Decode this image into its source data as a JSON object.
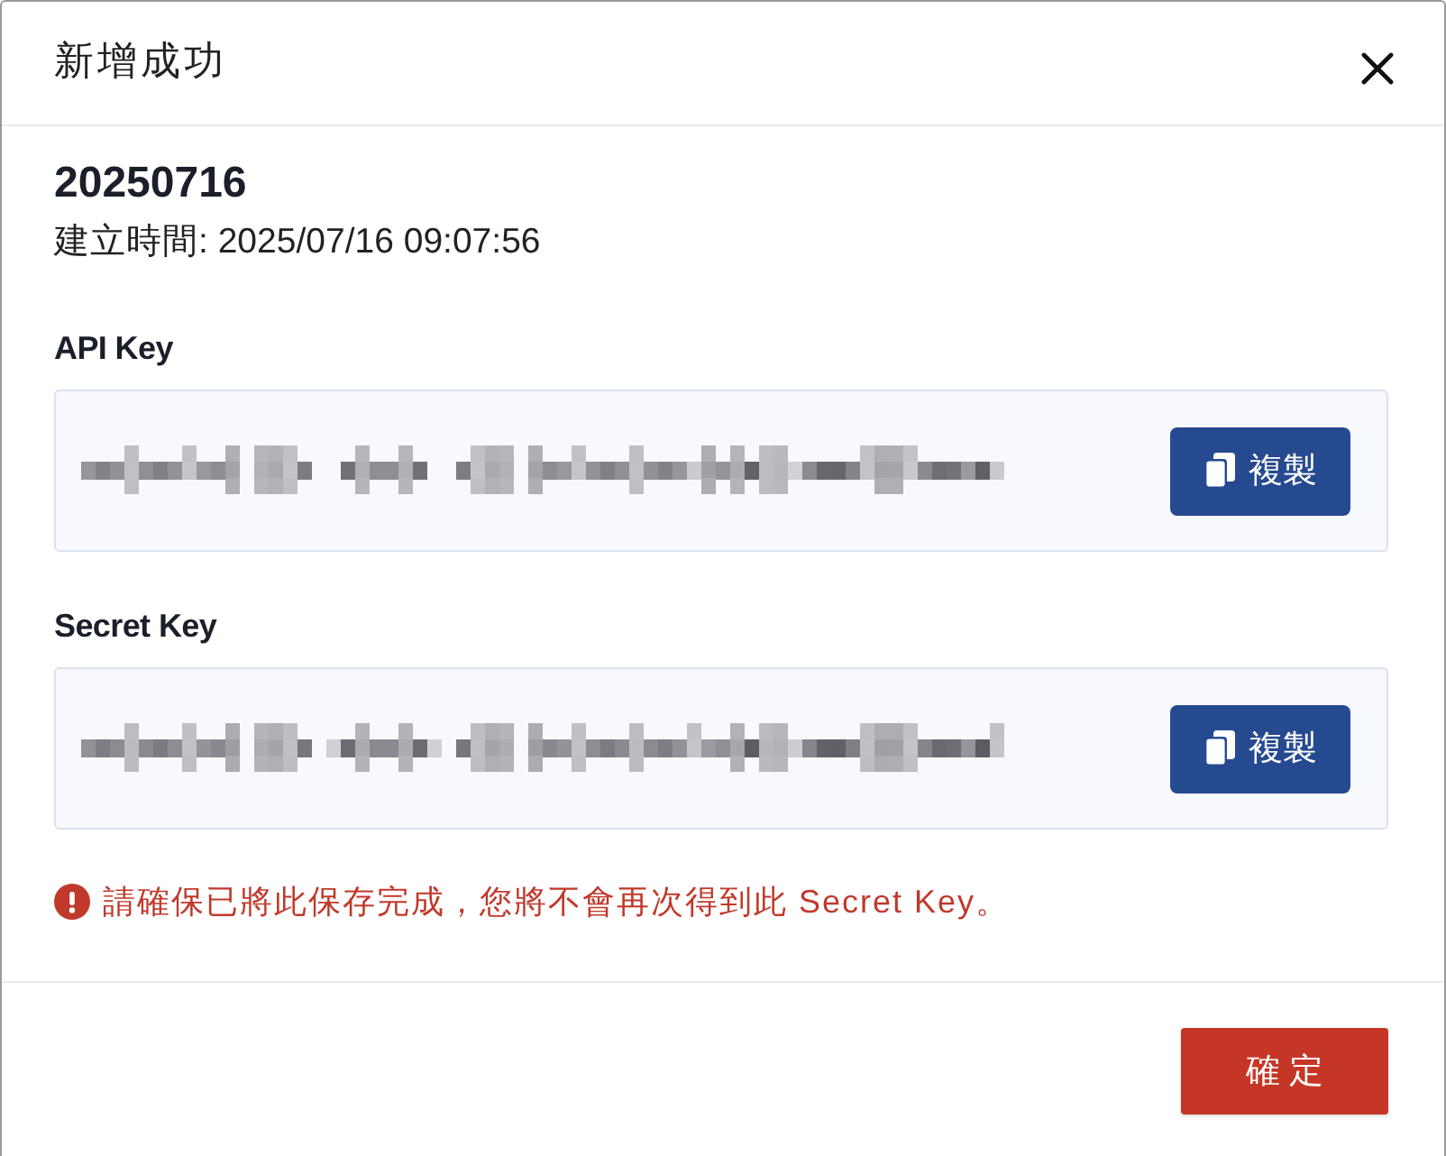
{
  "dialog": {
    "title": "新增成功"
  },
  "record": {
    "name": "20250716",
    "created": "建立時間: 2025/07/16 09:07:56"
  },
  "keys": [
    {
      "label": "API Key",
      "copy_button": "複製"
    },
    {
      "label": "Secret Key",
      "copy_button": "複製"
    }
  ],
  "warning": {
    "text": "請確保已將此保存完成，您將不會再次得到此 Secret Key。"
  },
  "footer": {
    "confirm_button": "確 定"
  }
}
